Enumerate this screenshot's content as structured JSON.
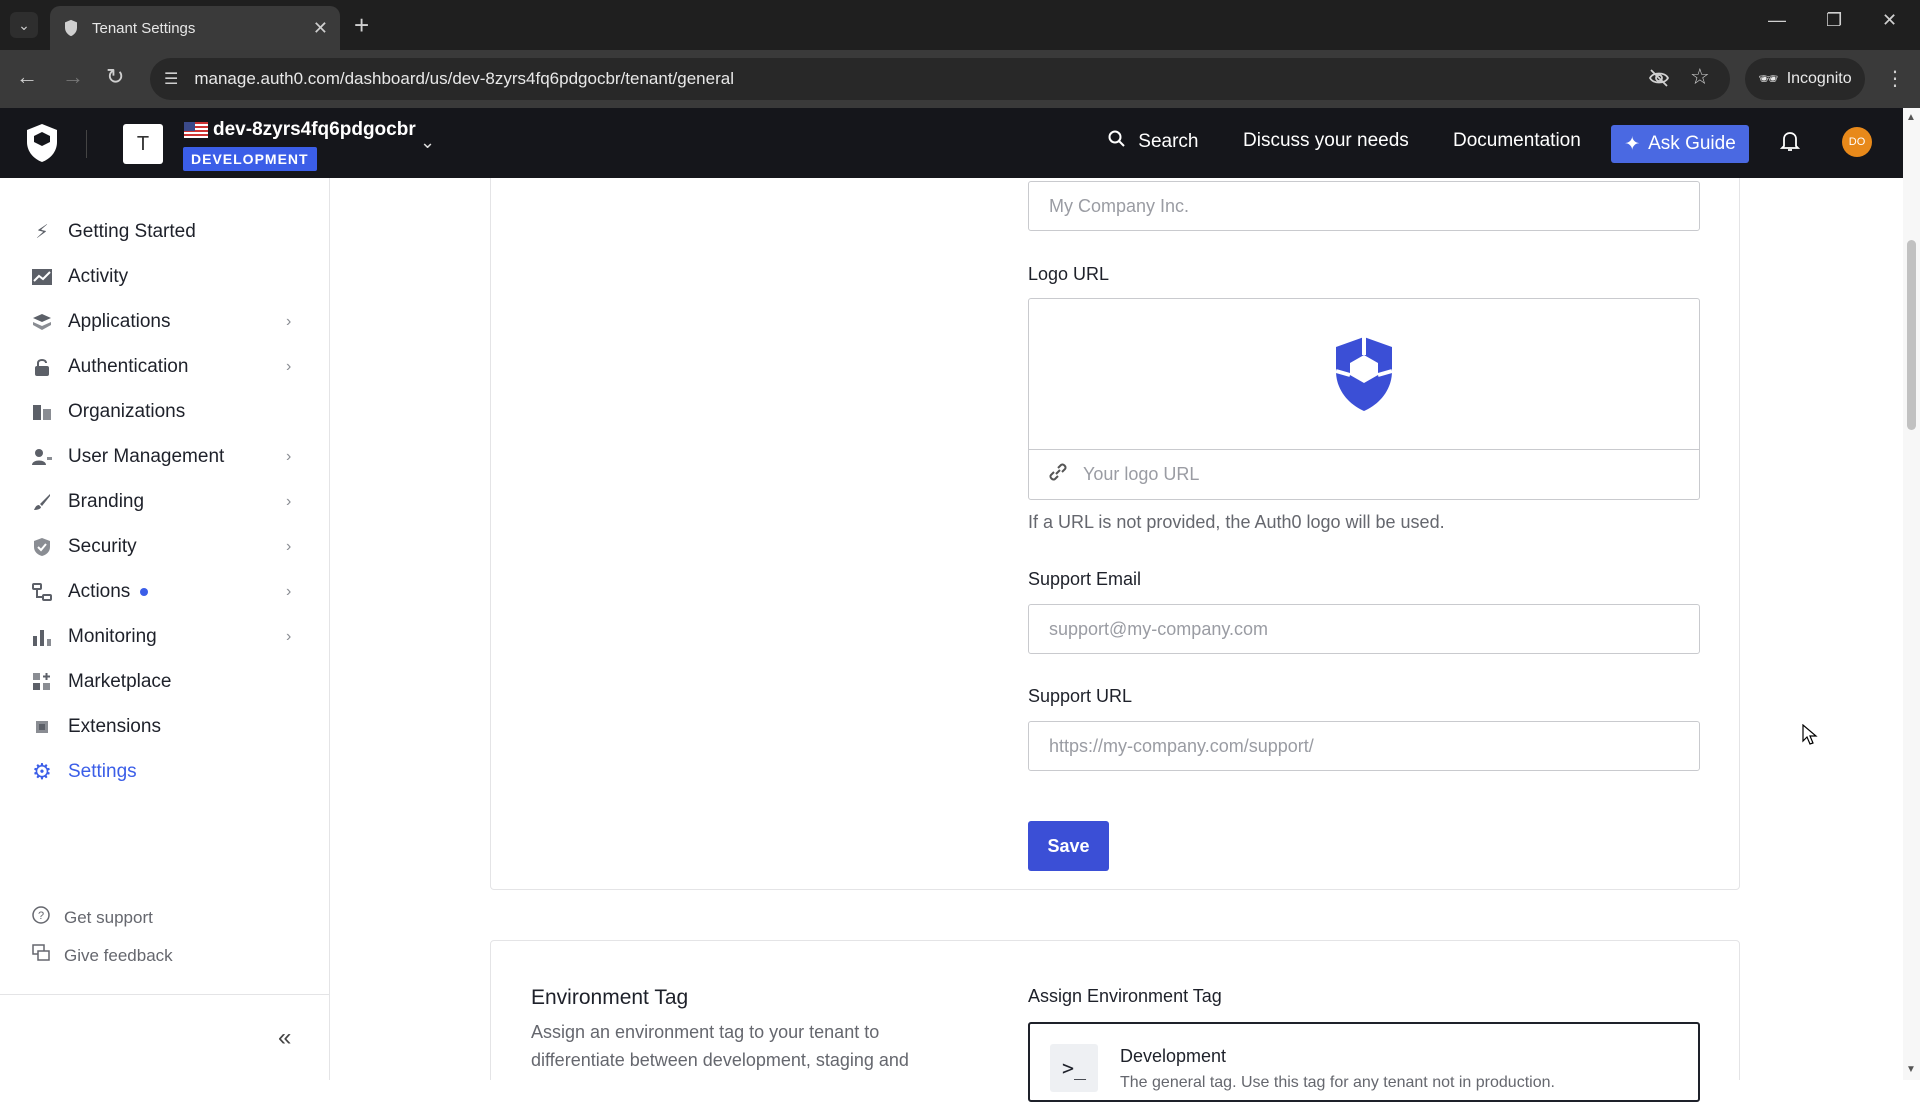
{
  "browser": {
    "tab_title": "Tenant Settings",
    "url": "manage.auth0.com/dashboard/us/dev-8zyrs4fq6pdgocbr/tenant/general",
    "incognito_label": "Incognito"
  },
  "header": {
    "tenant_initial": "T",
    "tenant_name": "dev-8zyrs4fq6pdgocbr",
    "env_badge": "DEVELOPMENT",
    "search_label": "Search",
    "discuss_label": "Discuss your needs",
    "docs_label": "Documentation",
    "ask_guide_label": "Ask Guide",
    "user_initials": "DO"
  },
  "sidebar": {
    "items": [
      {
        "label": "Getting Started",
        "icon": "bolt-icon"
      },
      {
        "label": "Activity",
        "icon": "activity-icon"
      },
      {
        "label": "Applications",
        "icon": "layers-icon"
      },
      {
        "label": "Authentication",
        "icon": "lock-icon"
      },
      {
        "label": "Organizations",
        "icon": "building-icon"
      },
      {
        "label": "User Management",
        "icon": "users-icon"
      },
      {
        "label": "Branding",
        "icon": "brush-icon"
      },
      {
        "label": "Security",
        "icon": "shield-check-icon"
      },
      {
        "label": "Actions",
        "icon": "flow-icon"
      },
      {
        "label": "Monitoring",
        "icon": "bar-chart-icon"
      },
      {
        "label": "Marketplace",
        "icon": "grid-plus-icon"
      },
      {
        "label": "Extensions",
        "icon": "chip-icon"
      },
      {
        "label": "Settings",
        "icon": "gear-icon"
      }
    ],
    "get_support": "Get support",
    "give_feedback": "Give feedback"
  },
  "form": {
    "company_placeholder": "My Company Inc.",
    "logo_url_label": "Logo URL",
    "logo_url_placeholder": "Your logo URL",
    "logo_help": "If a URL is not provided, the Auth0 logo will be used.",
    "support_email_label": "Support Email",
    "support_email_placeholder": "support@my-company.com",
    "support_url_label": "Support URL",
    "support_url_placeholder": "https://my-company.com/support/",
    "save_label": "Save"
  },
  "environment": {
    "title": "Environment Tag",
    "description": "Assign an environment tag to your tenant to differentiate between development, staging and",
    "assign_label": "Assign Environment Tag",
    "option_name": "Development",
    "option_sub": "The general tag. Use this tag for any tenant not in production."
  },
  "colors": {
    "accent": "#3b5ee8",
    "header_bg": "#15161b",
    "save_button": "#3b4fd6",
    "auth0_logo_blue": "#3b4fd6"
  }
}
